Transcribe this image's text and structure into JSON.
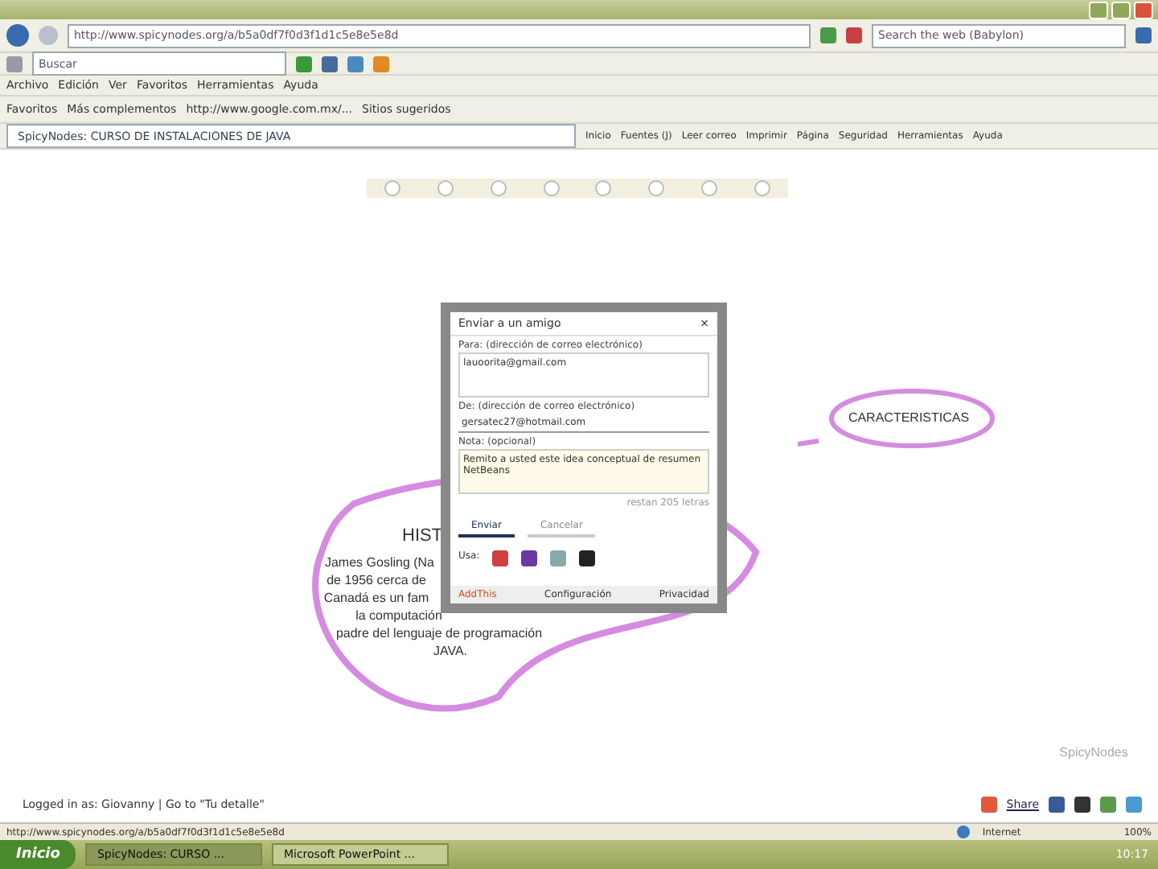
{
  "address_bar": {
    "url": "http://www.spicynodes.org/a/b5a0df7f0d3f1d1c5e8e5e8d",
    "search_placeholder": "Search the web (Babylon)"
  },
  "toolbar": {
    "search_value": "Buscar"
  },
  "menu": [
    "Archivo",
    "Edición",
    "Ver",
    "Favoritos",
    "Herramientas",
    "Ayuda"
  ],
  "favorites": {
    "label": "Favoritos",
    "links": [
      "Más complementos",
      "http://www.google.com.mx/...",
      "Sitios sugeridos"
    ]
  },
  "tab": {
    "title": "SpicyNodes: CURSO DE INSTALACIONES DE JAVA"
  },
  "commands": [
    "Inicio",
    "Fuentes (J)",
    "Leer correo",
    "Imprimir",
    "Página",
    "Seguridad",
    "Herramientas",
    "Ayuda"
  ],
  "map": {
    "feature_node": "CARACTERISTICAS",
    "history_title": "HIST",
    "history_lines": [
      "James Gosling (Na",
      "de 1956 cerca de",
      "Canadá es un fam",
      "la computación",
      "padre del lenguaje de programación",
      "JAVA."
    ],
    "logo": "SpicyNodes"
  },
  "dialog": {
    "title": "Enviar a un amigo",
    "close": "×",
    "to_label": "Para: (dirección de correo electrónico)",
    "to_value": "lauoorita@gmail.com",
    "from_label": "De: (dirección de correo electrónico)",
    "from_value": "gersatec27@hotmail.com",
    "note_label": "Nota: (opcional)",
    "note_value": "Remito a usted este idea conceptual de resumen NetBeans",
    "remaining": "restan 205 letras",
    "tabs": [
      {
        "label": "Enviar",
        "selected": true
      },
      {
        "label": "Cancelar",
        "selected": false
      }
    ],
    "use_label": "Usa:",
    "brand": "AddThis",
    "settings": "Configuración",
    "privacy": "Privacidad"
  },
  "footer": {
    "login": "Logged in as: Giovanny | Go to \"Tu detalle\"",
    "share": "Share"
  },
  "status_bar": {
    "url": "http://www.spicynodes.org/a/b5a0df7f0d3f1d1c5e8e5e8d",
    "zone": "Internet",
    "zoom": "100%"
  },
  "taskbar": {
    "start": "Inicio",
    "tasks": [
      {
        "label": "SpicyNodes: CURSO ...",
        "selected": true
      },
      {
        "label": "Microsoft PowerPoint ...",
        "selected": false
      }
    ],
    "clock": "10:17"
  }
}
